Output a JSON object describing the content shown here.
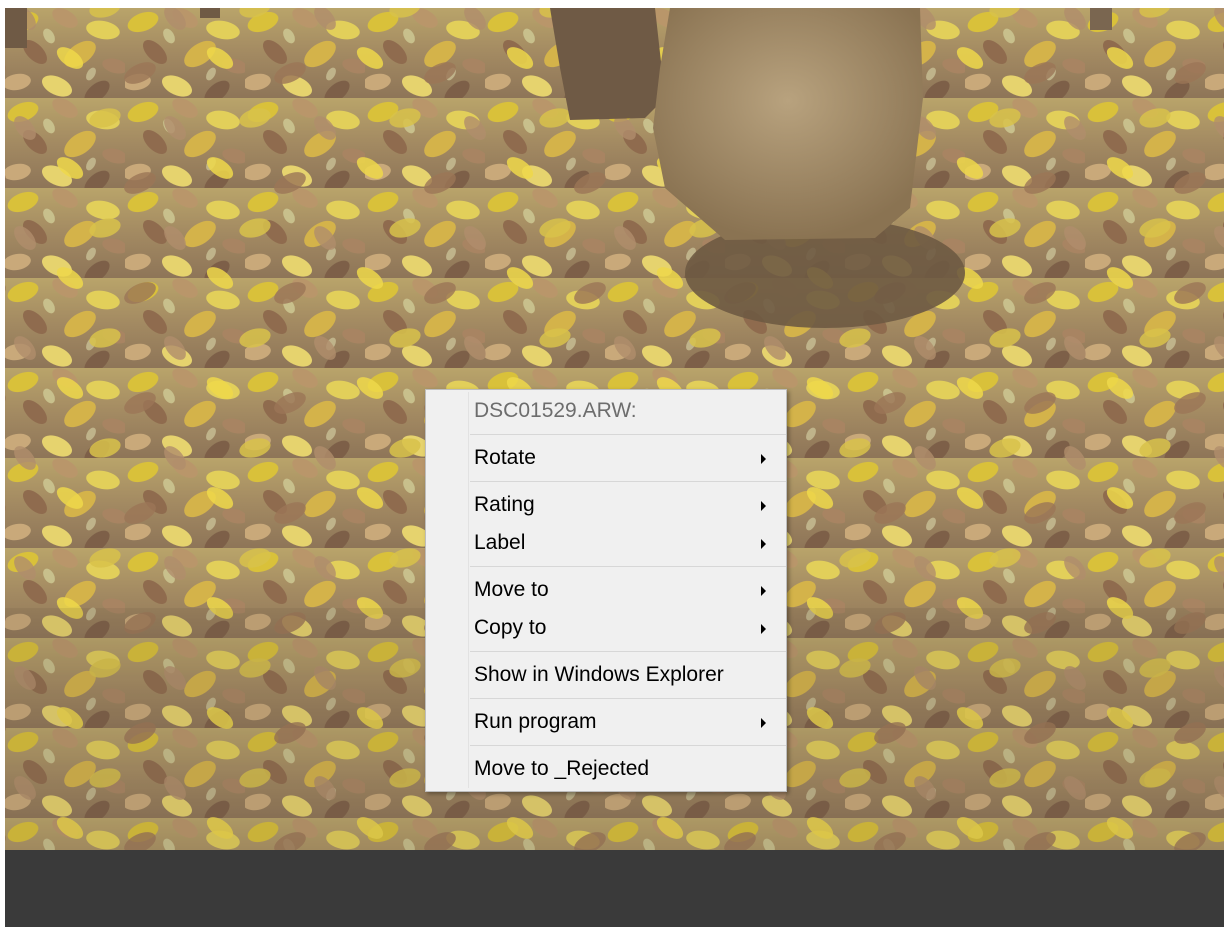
{
  "background_photo": {
    "subject": "tree-trunks-fallen-autumn-leaves",
    "colors": {
      "leaf_yellow": "#d9c13a",
      "leaf_brown": "#8a6a4a",
      "trunk": "#a08b6a",
      "soil": "#6e5a42"
    }
  },
  "status_bar": {
    "color": "#3a3a3a"
  },
  "context_menu": {
    "header": "DSC01529.ARW:",
    "items": {
      "rotate": "Rotate",
      "rating": "Rating",
      "label": "Label",
      "move_to": "Move to",
      "copy_to": "Copy to",
      "show_in_explorer": "Show in Windows Explorer",
      "run_program": "Run program",
      "move_to_rejected": "Move to _Rejected"
    },
    "submenu_indicator_icon": "chevron-right-icon"
  }
}
